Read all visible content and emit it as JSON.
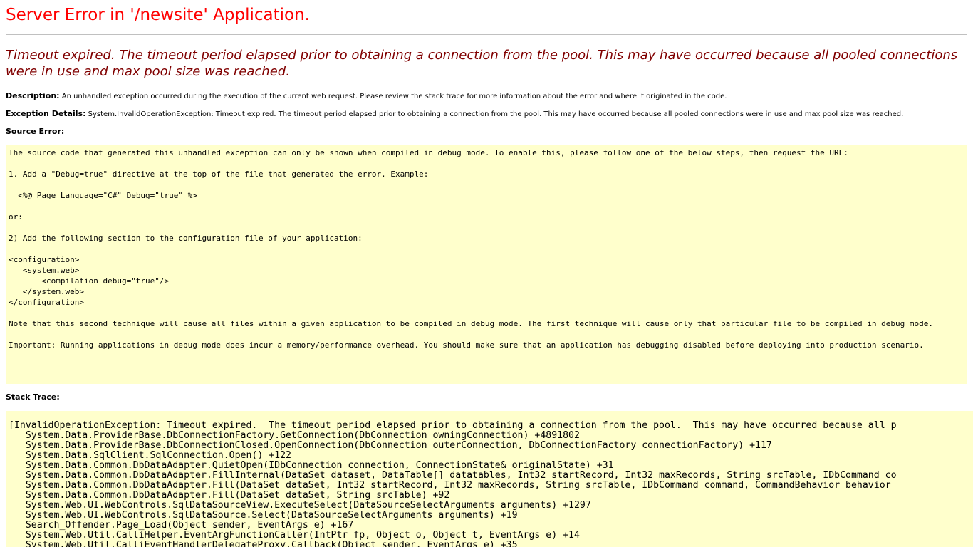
{
  "page": {
    "title": "Server Error in '/newsite' Application.",
    "error_message": "Timeout expired.  The timeout period elapsed prior to obtaining a connection from the pool.  This may have occurred because all pooled connections were in use and max pool size was reached."
  },
  "description": {
    "label": "Description:",
    "text": " An unhandled exception occurred during the execution of the current web request. Please review the stack trace for more information about the error and where it originated in the code."
  },
  "exception_details": {
    "label": "Exception Details:",
    "text": " System.InvalidOperationException: Timeout expired.  The timeout period elapsed prior to obtaining a connection from the pool.  This may have occurred because all pooled connections were in use and max pool size was reached."
  },
  "source_error": {
    "label": "Source Error:",
    "text": "The source code that generated this unhandled exception can only be shown when compiled in debug mode. To enable this, please follow one of the below steps, then request the URL:\n\n1. Add a \"Debug=true\" directive at the top of the file that generated the error. Example:\n\n  <%@ Page Language=\"C#\" Debug=\"true\" %>\n\nor:\n\n2) Add the following section to the configuration file of your application:\n\n<configuration>\n   <system.web>\n       <compilation debug=\"true\"/>\n   </system.web>\n</configuration>\n\nNote that this second technique will cause all files within a given application to be compiled in debug mode. The first technique will cause only that particular file to be compiled in debug mode.\n\nImportant: Running applications in debug mode does incur a memory/performance overhead. You should make sure that an application has debugging disabled before deploying into production scenario."
  },
  "stack_trace": {
    "label": "Stack Trace:",
    "text": "[InvalidOperationException: Timeout expired.  The timeout period elapsed prior to obtaining a connection from the pool.  This may have occurred because all p\n   System.Data.ProviderBase.DbConnectionFactory.GetConnection(DbConnection owningConnection) +4891802\n   System.Data.ProviderBase.DbConnectionClosed.OpenConnection(DbConnection outerConnection, DbConnectionFactory connectionFactory) +117\n   System.Data.SqlClient.SqlConnection.Open() +122\n   System.Data.Common.DbDataAdapter.QuietOpen(IDbConnection connection, ConnectionState& originalState) +31\n   System.Data.Common.DbDataAdapter.FillInternal(DataSet dataset, DataTable[] datatables, Int32 startRecord, Int32 maxRecords, String srcTable, IDbCommand co\n   System.Data.Common.DbDataAdapter.Fill(DataSet dataSet, Int32 startRecord, Int32 maxRecords, String srcTable, IDbCommand command, CommandBehavior behavior\n   System.Data.Common.DbDataAdapter.Fill(DataSet dataSet, String srcTable) +92\n   System.Web.UI.WebControls.SqlDataSourceView.ExecuteSelect(DataSourceSelectArguments arguments) +1297\n   System.Web.UI.WebControls.SqlDataSource.Select(DataSourceSelectArguments arguments) +19\n   Search_Offender.Page_Load(Object sender, EventArgs e) +167\n   System.Web.Util.CalliHelper.EventArgFunctionCaller(IntPtr fp, Object o, Object t, EventArgs e) +14\n   System.Web.Util.CalliEventHandlerDelegateProxy.Callback(Object sender, EventArgs e) +35"
  },
  "colors": {
    "title": "#ff0000",
    "error_message": "#800000",
    "code_background": "#ffffcc"
  }
}
